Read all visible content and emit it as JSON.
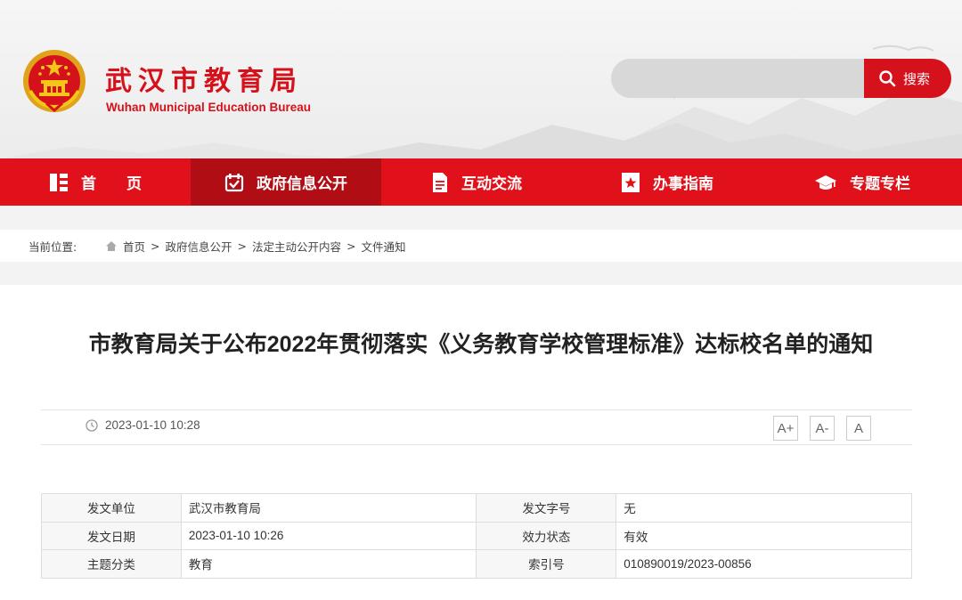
{
  "header": {
    "title": "武汉市教育局",
    "subtitle": "Wuhan Municipal Education Bureau",
    "search_placeholder": "",
    "search_label": "搜索"
  },
  "nav": [
    {
      "label": "首　　页",
      "icon": "home-grid-icon"
    },
    {
      "label": "政府信息公开",
      "icon": "calendar-check-icon"
    },
    {
      "label": "互动交流",
      "icon": "document-icon"
    },
    {
      "label": "办事指南",
      "icon": "bookmark-star-icon"
    },
    {
      "label": "专题专栏",
      "icon": "graduation-cap-icon"
    }
  ],
  "breadcrumb": {
    "label": "当前位置:",
    "items": [
      "首页",
      "政府信息公开",
      "法定主动公开内容",
      "文件通知"
    ],
    "separator": ">"
  },
  "article": {
    "title": "市教育局关于公布2022年贯彻落实《义务教育学校管理标准》达标校名单的通知",
    "date": "2023-01-10 10:28",
    "font_buttons": [
      "A+",
      "A-",
      "A"
    ]
  },
  "info_table": [
    {
      "k1": "发文单位",
      "v1": "武汉市教育局",
      "k2": "发文字号",
      "v2": "无"
    },
    {
      "k1": "发文日期",
      "v1": "2023-01-10 10:26",
      "k2": "效力状态",
      "v2": "有效"
    },
    {
      "k1": "主题分类",
      "v1": "教育",
      "k2": "索引号",
      "v2": "010890019/2023-00856"
    }
  ],
  "colors": {
    "brand_red": "#e0111a",
    "active_nav": "#b00d15",
    "title_red": "#d5121b"
  }
}
